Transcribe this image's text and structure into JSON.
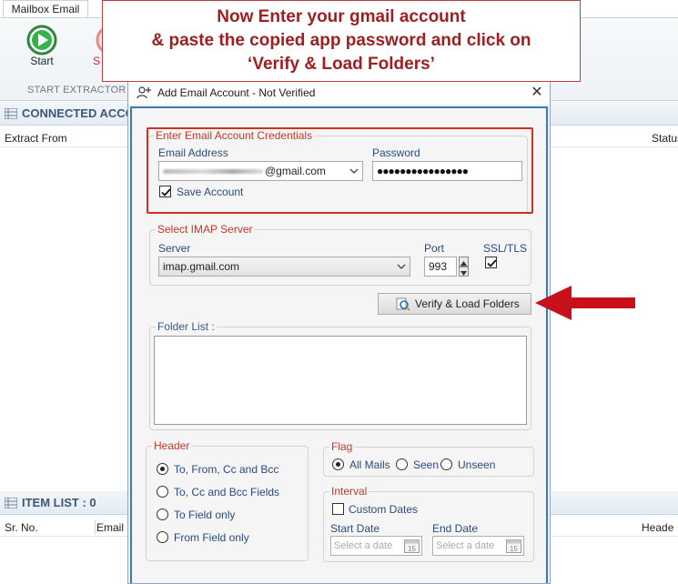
{
  "app": {
    "tab_label": "Mailbox Email",
    "start_label": "Start",
    "stop_label_partial": "S",
    "group_label": "START EXTRACTOR",
    "connected_panel_title": "CONNECTED ACCO",
    "connected_columns": [
      "Extract From",
      "Status"
    ],
    "item_panel_title": "ITEM LIST : 0",
    "item_columns": [
      "Sr. No.",
      "Email",
      "Heade"
    ]
  },
  "annotation": {
    "line1": "Now Enter your gmail account",
    "line2": "& paste the copied app password and click on",
    "line3": "‘Verify & Load Folders’",
    "color": "#9e1f22"
  },
  "dialog": {
    "title": "Add Email Account - Not Verified",
    "close_glyph": "✕",
    "credentials": {
      "group_title": "Enter Email Account Credentials",
      "email_label": "Email Address",
      "email_value": "@gmail.com",
      "password_label": "Password",
      "password_value": "●●●●●●●●●●●●●●●●",
      "save_account_label": "Save Account",
      "save_account_checked": true
    },
    "imap": {
      "group_title": "Select IMAP Server",
      "server_label": "Server",
      "server_value": "imap.gmail.com",
      "port_label": "Port",
      "port_value": "993",
      "ssl_label": "SSL/TLS",
      "ssl_checked": true
    },
    "verify_button_label": "Verify & Load Folders",
    "folder_list_title": "Folder List :",
    "header_group": {
      "title": "Header",
      "options": [
        "To, From, Cc and Bcc",
        "To, Cc and Bcc Fields",
        "To Field only",
        "From Field only"
      ],
      "selected": "To, From, Cc and Bcc"
    },
    "flag_group": {
      "title": "Flag",
      "options": [
        "All Mails",
        "Seen",
        "Unseen"
      ],
      "selected": "All Mails"
    },
    "interval_group": {
      "title": "Interval",
      "custom_dates_label": "Custom Dates",
      "start_date_label": "Start Date",
      "end_date_label": "End Date",
      "start_date_placeholder": "Select a date",
      "end_date_placeholder": "Select a date",
      "calendar_day": "15"
    }
  },
  "colors": {
    "highlight": "#d0301f",
    "dialog_border": "#3b78b5",
    "panel_header_text": "#3d5875"
  }
}
